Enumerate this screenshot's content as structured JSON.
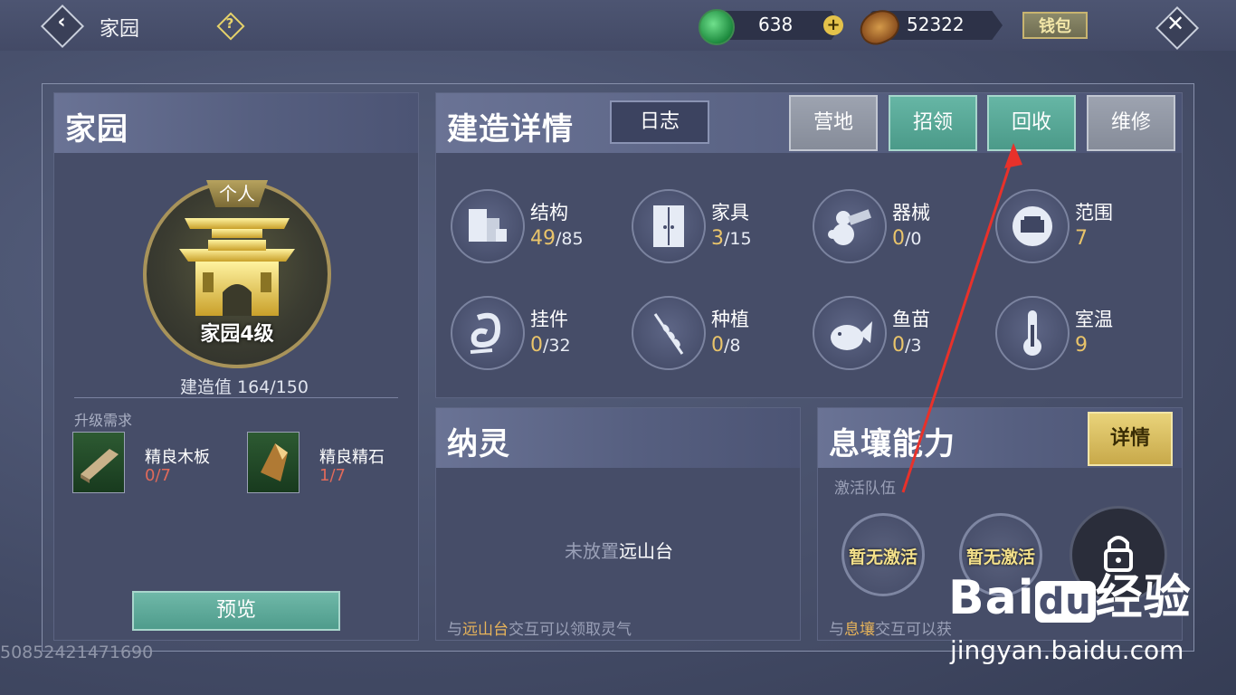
{
  "topbar": {
    "title": "家园",
    "jade_amount": "638",
    "coin_amount": "52322",
    "wallet_label": "钱包"
  },
  "left_panel": {
    "title": "家园",
    "emblem_tag": "个人",
    "emblem_level": "家园4级",
    "build_value": "建造值 164/150",
    "requirements_label": "升级需求",
    "materials": [
      {
        "name": "精良木板",
        "count": "0/7"
      },
      {
        "name": "精良精石",
        "count": "1/7"
      }
    ],
    "preview_label": "预览"
  },
  "build_panel": {
    "title": "建造详情",
    "log_label": "日志",
    "tabs": [
      {
        "label": "营地",
        "style": "gray"
      },
      {
        "label": "招领",
        "style": "teal"
      },
      {
        "label": "回收",
        "style": "teal"
      },
      {
        "label": "维修",
        "style": "gray"
      }
    ],
    "stats": [
      {
        "label": "结构",
        "current": "49",
        "max": "/85",
        "icon": "structure-icon"
      },
      {
        "label": "家具",
        "current": "3",
        "max": "/15",
        "icon": "furniture-icon"
      },
      {
        "label": "器械",
        "current": "0",
        "max": "/0",
        "icon": "machine-icon"
      },
      {
        "label": "范围",
        "current": "7",
        "max": "",
        "icon": "range-icon"
      },
      {
        "label": "挂件",
        "current": "0",
        "max": "/32",
        "icon": "pendant-icon"
      },
      {
        "label": "种植",
        "current": "0",
        "max": "/8",
        "icon": "planting-icon"
      },
      {
        "label": "鱼苗",
        "current": "0",
        "max": "/3",
        "icon": "fish-icon"
      },
      {
        "label": "室温",
        "current": "9",
        "max": "",
        "icon": "thermometer-icon"
      }
    ]
  },
  "nalin_panel": {
    "title": "纳灵",
    "empty_prefix": "未放置",
    "empty_item": "远山台",
    "footer_prefix": "与",
    "footer_item": "远山台",
    "footer_suffix": "交互可以领取灵气"
  },
  "ability_panel": {
    "title": "息壤能力",
    "detail_label": "详情",
    "team_label": "激活队伍",
    "slots": [
      "暂无激活",
      "暂无激活"
    ],
    "footer_prefix": "与",
    "footer_item": "息壤",
    "footer_suffix": "交互可以获"
  },
  "user_id": "50852421471690",
  "watermark": {
    "brand": "Bai",
    "brand2": "经验",
    "url": "jingyan.baidu.com"
  },
  "colors": {
    "accent_teal": "#5aa898",
    "accent_gold": "#e9c46a",
    "annotation_red": "#e8312a"
  }
}
